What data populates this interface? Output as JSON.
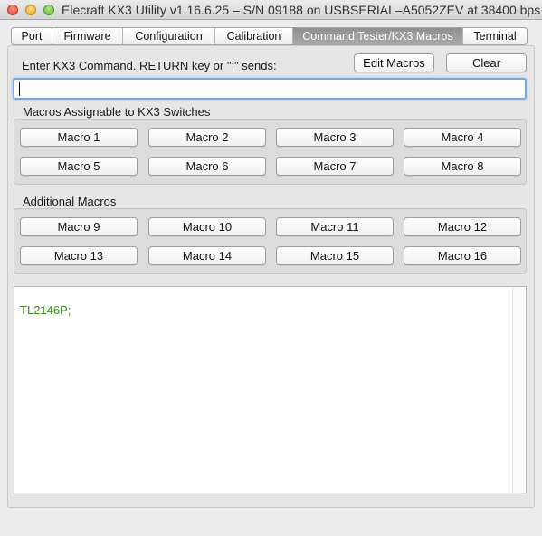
{
  "window": {
    "title": "Elecraft KX3 Utility v1.16.6.25 – S/N 09188 on USBSERIAL–A5052ZEV at 38400 bps"
  },
  "tabs": [
    {
      "label": "Port",
      "active": false
    },
    {
      "label": "Firmware",
      "active": false
    },
    {
      "label": "Configuration",
      "active": false
    },
    {
      "label": "Calibration",
      "active": false
    },
    {
      "label": "Command Tester/KX3 Macros",
      "active": true
    },
    {
      "label": "Terminal",
      "active": false
    }
  ],
  "command": {
    "label": "Enter KX3 Command. RETURN key or \";\" sends:",
    "input_value": "",
    "edit_macros_label": "Edit Macros",
    "clear_label": "Clear"
  },
  "switch_macros": {
    "label": "Macros Assignable to KX3 Switches",
    "buttons": [
      "Macro 1",
      "Macro 2",
      "Macro 3",
      "Macro 4",
      "Macro 5",
      "Macro 6",
      "Macro 7",
      "Macro 8"
    ]
  },
  "additional_macros": {
    "label": "Additional Macros",
    "buttons": [
      "Macro 9",
      "Macro 10",
      "Macro 11",
      "Macro 12",
      "Macro 13",
      "Macro 14",
      "Macro 15",
      "Macro 16"
    ]
  },
  "console": {
    "text": "TL2146P;",
    "text_color": "#3a8a1e"
  }
}
